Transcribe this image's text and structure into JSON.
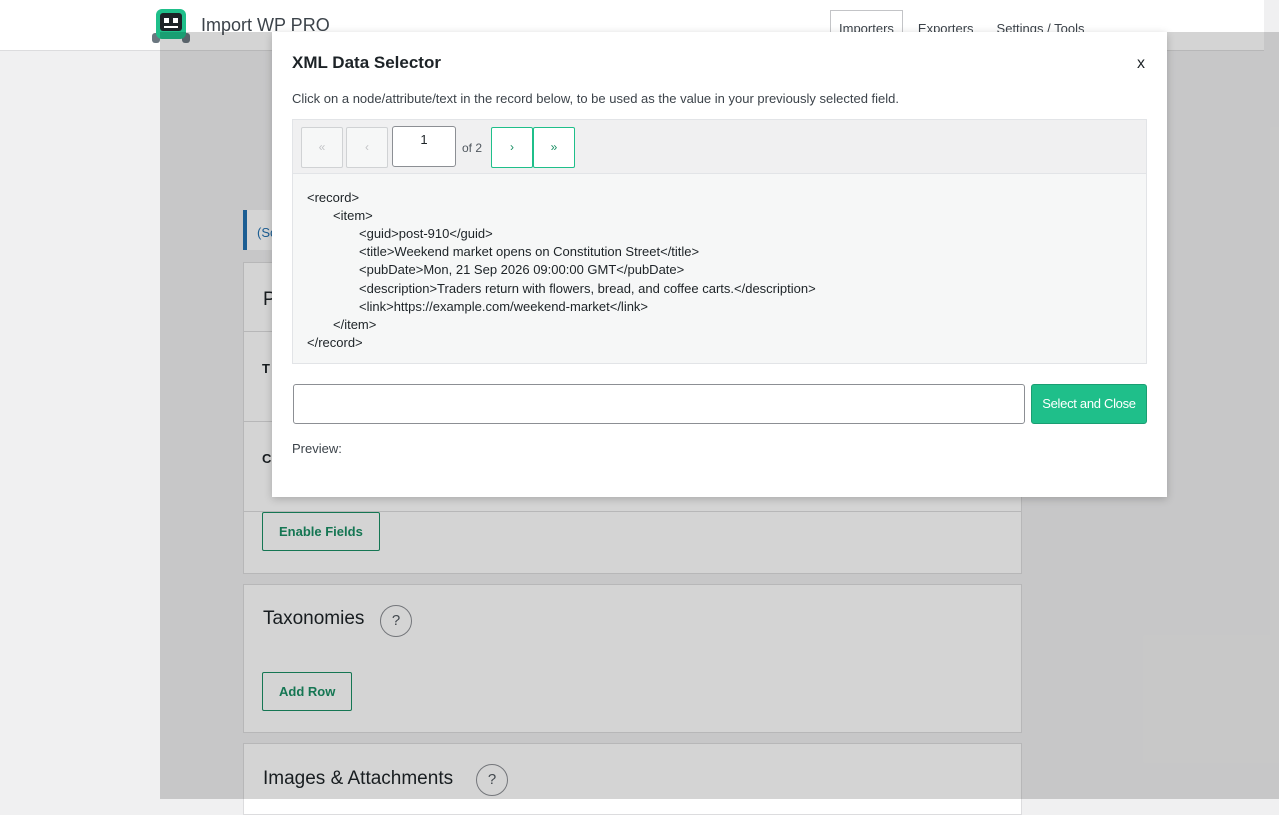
{
  "header": {
    "brand": "Import WP PRO",
    "nav": [
      "Importers",
      "Exporters",
      "Settings / Tools"
    ]
  },
  "background": {
    "notice_text": "(Sc",
    "panel_title_partial": "P",
    "label_t": "T",
    "label_c": "C",
    "enable_fields": "Enable Fields",
    "taxonomies_title": "Taxonomies",
    "add_row": "Add Row",
    "images_title": "Images & Attachments",
    "help_symbol": "?"
  },
  "modal": {
    "title": "XML Data Selector",
    "close": "x",
    "description": "Click on a node/attribute/text in the record below, to be used as the value in your previously selected field.",
    "pager": {
      "first": "«",
      "prev": "‹",
      "current": "1",
      "of": "of 2",
      "next": "›",
      "last": "»"
    },
    "xml_lines": [
      "<record>",
      "<item>",
      "<guid>post-910</guid>",
      "<title>Weekend market opens on Constitution Street</title>",
      "<pubDate>Mon, 21 Sep 2026 09:00:00 GMT</pubDate>",
      "<description>Traders return with flowers, bread, and coffee carts.</description>",
      "<link>https://example.com/weekend-market</link>",
      "</item>",
      "</record>"
    ],
    "selector_value": "",
    "select_button": "Select and Close",
    "preview_label": "Preview:"
  },
  "colors": {
    "accent": "#1fbf8a",
    "accent_dark": "#1a8f64",
    "link_blue": "#2271b1"
  }
}
